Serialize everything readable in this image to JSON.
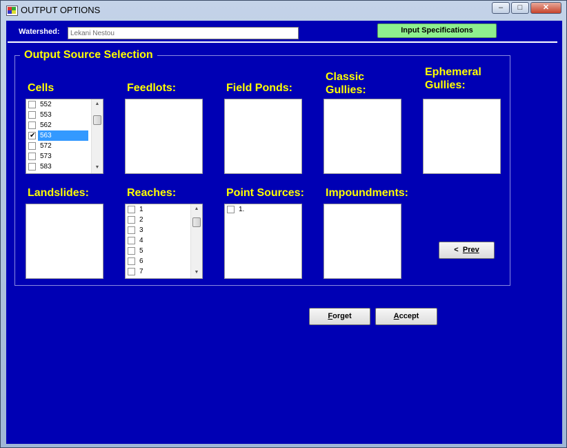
{
  "window": {
    "title": "OUTPUT OPTIONS",
    "controls": {
      "minimize": "‒",
      "maximize": "□",
      "close": "✕"
    }
  },
  "header": {
    "watershed_label": "Watershed:",
    "watershed_value": "Lekani Nestou",
    "input_spec_button": "Input Specifications"
  },
  "group": {
    "title": "Output Source Selection"
  },
  "labels": {
    "cells": "Cells",
    "feedlots": "Feedlots:",
    "field_ponds": "Field Ponds:",
    "classic_gullies": "Classic Gullies:",
    "ephemeral_gullies": "Ephemeral Gullies:",
    "landslides": "Landslides:",
    "reaches": "Reaches:",
    "point_sources": "Point Sources:",
    "impoundments": "Impoundments:"
  },
  "cells_list": [
    {
      "label": "552",
      "checked": false
    },
    {
      "label": "553",
      "checked": false
    },
    {
      "label": "562",
      "checked": false
    },
    {
      "label": "563",
      "checked": true
    },
    {
      "label": "572",
      "checked": false
    },
    {
      "label": "573",
      "checked": false
    },
    {
      "label": "583",
      "checked": false
    }
  ],
  "reaches_list": [
    {
      "label": "1"
    },
    {
      "label": "2"
    },
    {
      "label": "3"
    },
    {
      "label": "4"
    },
    {
      "label": "5"
    },
    {
      "label": "6"
    },
    {
      "label": "7"
    }
  ],
  "point_sources_list": [
    {
      "label": "1."
    }
  ],
  "buttons": {
    "prev_prefix": "<",
    "prev_mnemonic": "P",
    "prev_rest": "rev",
    "forget_mnemonic": "F",
    "forget_rest": "orget",
    "accept_mnemonic": "A",
    "accept_rest": "ccept"
  },
  "icons": {
    "check": "✔",
    "scroll_up": "▲",
    "scroll_down": "▼"
  },
  "colors": {
    "background": "#0000b4",
    "label": "#ffff00",
    "selection": "#3399ff",
    "input_spec": "#8ef08e"
  }
}
